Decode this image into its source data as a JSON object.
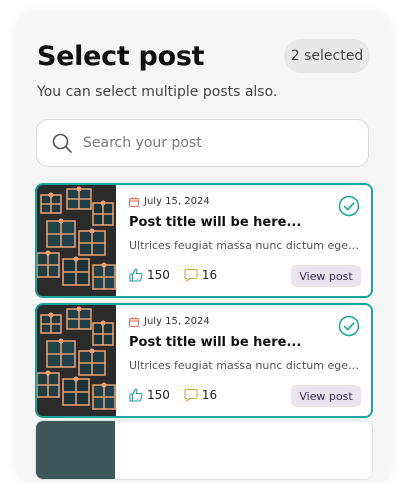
{
  "header": {
    "title": "Select post",
    "selected_badge": "2 selected",
    "subtitle": "You can select multiple posts also."
  },
  "search": {
    "placeholder": "Search your post",
    "value": ""
  },
  "posts": [
    {
      "date": "July 15, 2024",
      "title": "Post title will be here...",
      "excerpt": "Ultrices feugiat massa nunc dictum egest...",
      "likes": "150",
      "comments": "16",
      "view_label": "View post",
      "selected": true
    },
    {
      "date": "July 15, 2024",
      "title": "Post title will be here...",
      "excerpt": "Ultrices feugiat massa nunc dictum egest...",
      "likes": "150",
      "comments": "16",
      "view_label": "View post",
      "selected": true
    }
  ],
  "icons": {
    "search": "search-icon",
    "calendar": "calendar-icon",
    "check": "check-circle-icon",
    "like": "thumbs-up-icon",
    "comment": "comment-icon"
  },
  "colors": {
    "accent": "#1aa699",
    "calendar": "#e0655a",
    "comment": "#e8a33a",
    "button_bg": "#e9e4f0",
    "badge_bg": "#e8e8e8"
  }
}
